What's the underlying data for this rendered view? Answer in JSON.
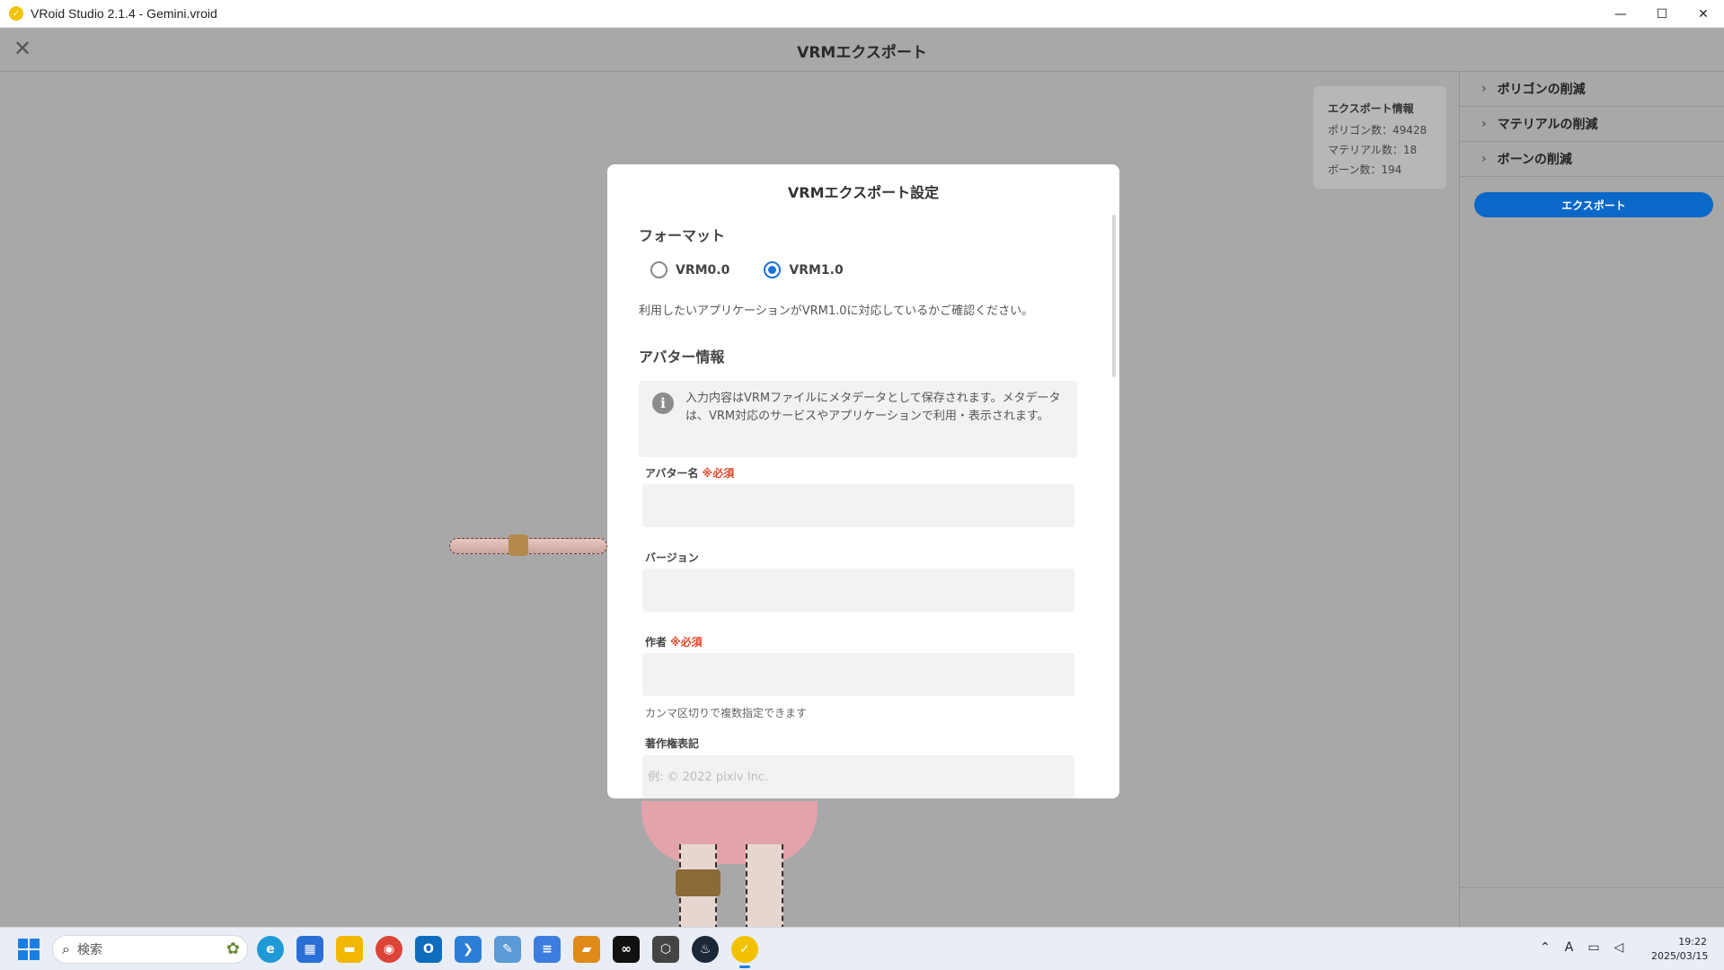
{
  "window": {
    "title": "VRoid Studio 2.1.4 - Gemini.vroid",
    "minimize": "—",
    "maximize": "☐",
    "close": "✕"
  },
  "header": {
    "title": "VRMエクスポート",
    "close_icon": "✕"
  },
  "export_info": {
    "title": "エクスポート情報",
    "polygons": "ポリゴン数：49428",
    "materials": "マテリアル数：18",
    "bones": "ボーン数：194"
  },
  "right_panel": {
    "items": [
      {
        "label": "ポリゴンの削減"
      },
      {
        "label": "マテリアルの削減"
      },
      {
        "label": "ボーンの削減"
      }
    ],
    "export_button": "エクスポート"
  },
  "modal": {
    "title": "VRMエクスポート設定",
    "format_heading": "フォーマット",
    "format_options": [
      {
        "label": "VRM0.0",
        "selected": false
      },
      {
        "label": "VRM1.0",
        "selected": true
      }
    ],
    "format_note": "利用したいアプリケーションがVRM1.0に対応しているかご確認ください。",
    "avatar_heading": "アバター情報",
    "info_text": "入力内容はVRMファイルにメタデータとして保存されます。メタデータは、VRM対応のサービスやアプリケーションで利用・表示されます。",
    "fields": {
      "avatar_name_label": "アバター名",
      "required_mark": "※必須",
      "avatar_name_value": "",
      "version_label": "バージョン",
      "version_value": "",
      "author_label": "作者",
      "author_value": "",
      "author_hint": "カンマ区切りで複数指定できます",
      "copyright_label": "著作権表記",
      "copyright_placeholder": "例: © 2022 pixiv Inc."
    }
  },
  "taskbar": {
    "search_placeholder": "検索",
    "clock_time": "19:22",
    "clock_date": "2025/03/15",
    "ime": "A",
    "accent": "#1b7fe0"
  }
}
